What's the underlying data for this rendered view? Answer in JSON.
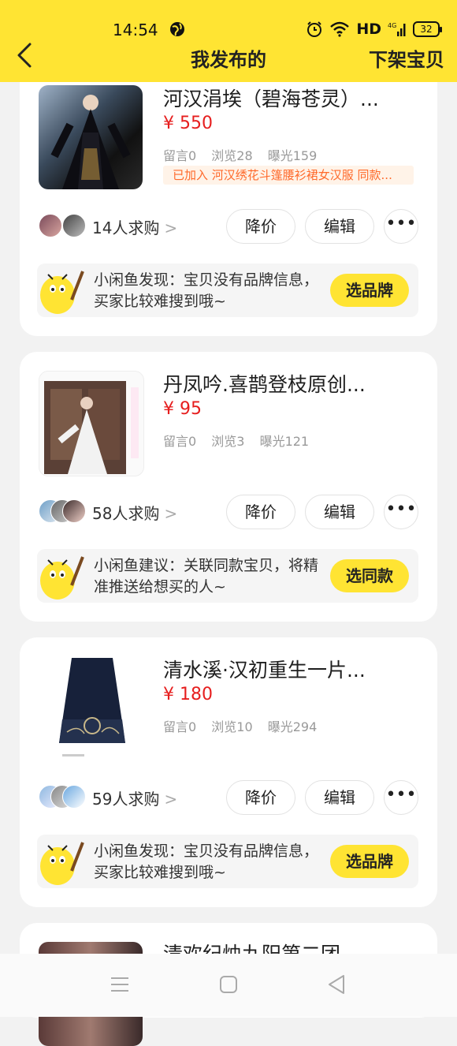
{
  "status_bar": {
    "time": "14:54",
    "network": "HD",
    "battery": "32"
  },
  "nav": {
    "title": "我发布的",
    "action": "下架宝贝"
  },
  "listings": [
    {
      "title": "河汉涓埃（碧海苍灵）...",
      "price": "¥ 550",
      "stats": {
        "messages": "留言0",
        "views": "浏览28",
        "exposure": "曝光159"
      },
      "tag": "已加入 河汉绣花斗篷腰衫裙女汉服 同款...",
      "wanted": "14人求购",
      "actions": {
        "reduce": "降价",
        "edit": "编辑"
      },
      "tip": {
        "text": "小闲鱼发现：宝贝没有品牌信息，买家比较难搜到哦~",
        "button": "选品牌"
      }
    },
    {
      "title": "丹凤吟.喜鹊登枝原创...",
      "price": "¥ 95",
      "stats": {
        "messages": "留言0",
        "views": "浏览3",
        "exposure": "曝光121"
      },
      "wanted": "58人求购",
      "actions": {
        "reduce": "降价",
        "edit": "编辑"
      },
      "tip": {
        "text": "小闲鱼建议：关联同款宝贝，将精准推送给想买的人~",
        "button": "选同款"
      }
    },
    {
      "title": "清水溪·汉初重生一片...",
      "price": "¥ 180",
      "stats": {
        "messages": "留言0",
        "views": "浏览10",
        "exposure": "曝光294"
      },
      "wanted": "59人求购",
      "actions": {
        "reduce": "降价",
        "edit": "编辑"
      },
      "tip": {
        "text": "小闲鱼发现：宝贝没有品牌信息，买家比较难搜到哦~",
        "button": "选品牌"
      }
    },
    {
      "title": "清欢纪烛九阳第二团"
    }
  ],
  "colors": {
    "accent": "#ffe433",
    "price": "#e61e1e",
    "tag": "#ff6a2b"
  },
  "icons": [
    "back-arrow-icon",
    "globe-icon",
    "alarm-icon",
    "wifi-icon",
    "signal-icon",
    "battery-icon",
    "chevron-right-icon",
    "more-dots-icon",
    "mascot-icon",
    "menu-icon",
    "home-icon",
    "back-icon"
  ]
}
